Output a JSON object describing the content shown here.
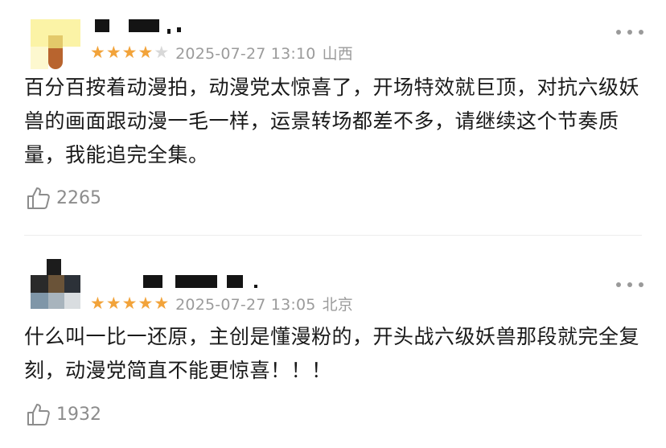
{
  "reviews": [
    {
      "rating": 4,
      "rating_max": 5,
      "date": "2025-07-27 13:10",
      "location": "山西",
      "text": "百分百按着动漫拍，动漫党太惊喜了，开场特效就巨顶，对抗六级妖兽的画面跟动漫一毛一样，运景转场都差不多，请继续这个节奏质量，我能追完全集。",
      "likes": "2265"
    },
    {
      "rating": 5,
      "rating_max": 5,
      "date": "2025-07-27 13:05",
      "location": "北京",
      "text": "什么叫一比一还原，主创是懂漫粉的，开头战六级妖兽那段就完全复刻，动漫党简直不能更惊喜！！！",
      "likes": "1932"
    }
  ],
  "icons": {
    "star": "star-icon",
    "like": "thumbs-up-icon",
    "menu": "more-dots-icon"
  },
  "colors": {
    "star_active": "#f2a33a",
    "star_inactive": "#d8d8d8",
    "meta_text": "#9b9b9b",
    "body_text": "#1a1a1a"
  }
}
